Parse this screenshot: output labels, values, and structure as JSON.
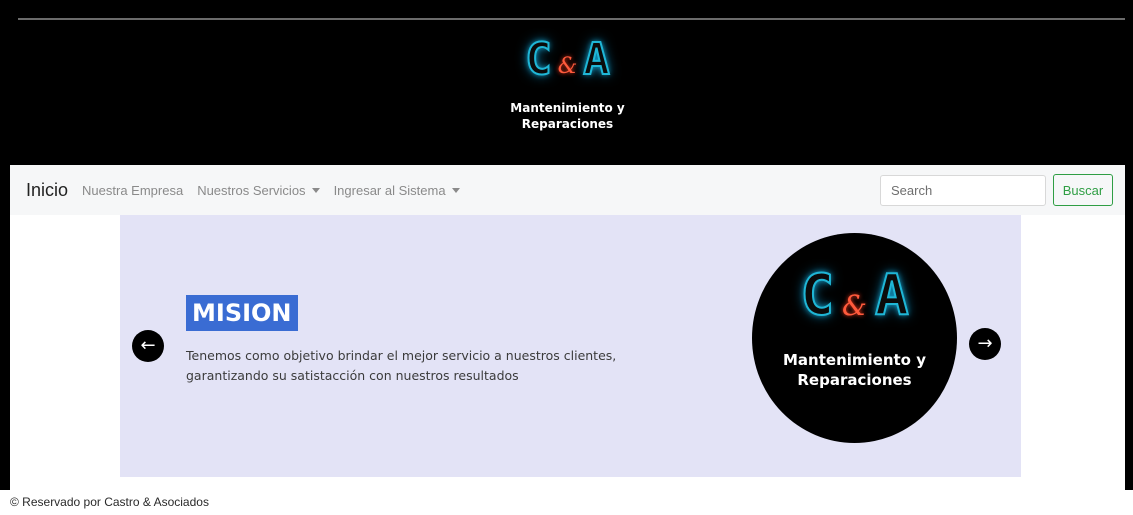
{
  "header": {
    "logo": {
      "c": "C",
      "amp": "&",
      "a": "A"
    },
    "subtitle": "Mantenimiento y Reparaciones"
  },
  "nav": {
    "brand": "Inicio",
    "items": [
      {
        "label": "Nuestra Empresa",
        "dropdown": false
      },
      {
        "label": "Nuestros Servicios",
        "dropdown": true
      },
      {
        "label": "Ingresar al Sistema",
        "dropdown": true
      }
    ],
    "search_placeholder": "Search",
    "search_button": "Buscar"
  },
  "carousel": {
    "title": "MISION",
    "text": "Tenemos como objetivo brindar el mejor servicio a nuestros clientes, garantizando su satistacción con nuestros resultados",
    "image": {
      "logo": {
        "c": "C",
        "amp": "&",
        "a": "A"
      },
      "subtitle": "Mantenimiento y Reparaciones"
    },
    "prev_icon": "arrow-left-icon",
    "next_icon": "arrow-right-icon",
    "background": "#e3e3f6",
    "title_background": "#3a6cd3"
  },
  "footer": {
    "text": "© Reservado por Castro & Asociados"
  },
  "colors": {
    "accent_green": "#2f9e44",
    "neon_cyan": "#1fb6d6",
    "neon_red": "#ff5a3c"
  }
}
